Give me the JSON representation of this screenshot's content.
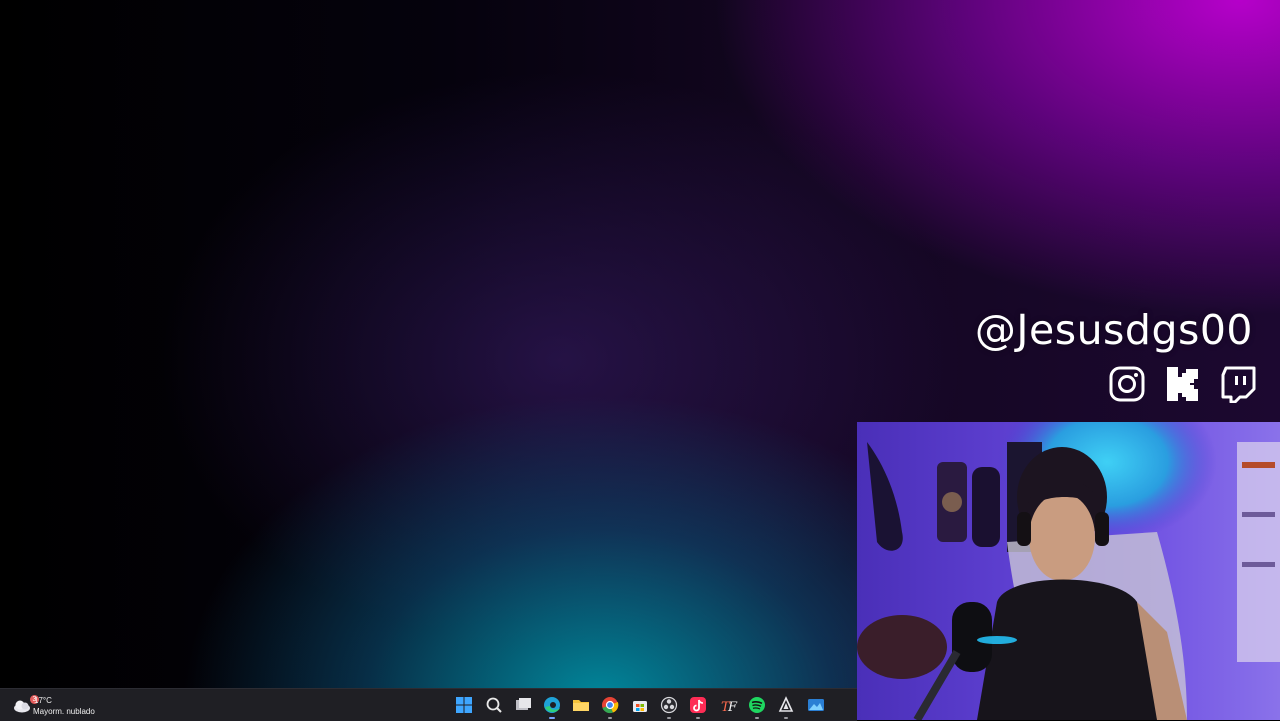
{
  "overlay": {
    "handle": "@Jesusdgs00",
    "socials": [
      "instagram-icon",
      "kick-icon",
      "twitch-icon"
    ]
  },
  "webcam": {
    "description_colors": {
      "backlight": "#5a3fd6",
      "lamp": "#2fb6e8"
    }
  },
  "taskbar": {
    "weather": {
      "temperature": "17°C",
      "condition": "Mayorm. nublado",
      "badge": "3"
    },
    "pinned_icons": [
      "windows-start-icon",
      "search-icon",
      "task-view-icon",
      "edge-icon",
      "file-explorer-icon",
      "chrome-icon",
      "microsoft-store-icon",
      "obs-icon",
      "tiktok-live-icon",
      "typeface-icon",
      "spotify-icon",
      "app-icon",
      "photos-icon"
    ]
  },
  "colors": {
    "accent_purple": "#b400d2",
    "accent_teal": "#0096aa",
    "taskbar_bg": "#1f1f24"
  }
}
